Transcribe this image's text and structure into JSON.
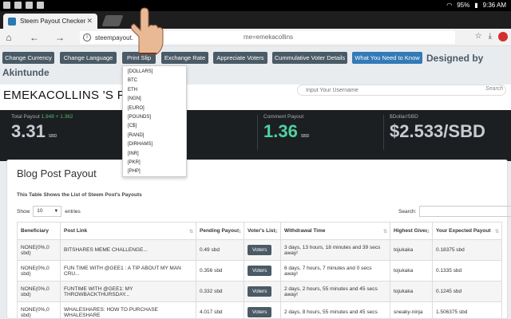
{
  "statusbar": {
    "battery": "95%",
    "time": "9:36 AM"
  },
  "browser": {
    "tab_title": "Steem Payout Checker",
    "url": "steempayout.",
    "url_tail": "me=emekacollins"
  },
  "nav": {
    "buttons": [
      "Change Currency",
      "Change Language",
      "Print Slip",
      "Exchange Rate",
      "Appreciate Voters",
      "Cummulative Voter Details",
      "What You Need to Know"
    ],
    "designed_by_1": "Designed by",
    "designed_by_2": "Akintunde"
  },
  "dropdown": [
    "[DOLLARS]",
    "BTC",
    "ETH",
    "[NGN]",
    "[EURO]",
    "[POUNDS]",
    "[C$]",
    "[RAND]",
    "[DIRHAMS]",
    "[INR]",
    "[PKR]",
    "[PHP]"
  ],
  "user": {
    "title": "EMEKACOLLINS 'S PAYO",
    "input_placeholder": "Input Your Username",
    "search_label": "Search"
  },
  "stats": {
    "total_label": "Total Payout",
    "total_detail": "1.948 + 1.362",
    "total_value": "3.31",
    "total_unit": "SBD",
    "comment_label": "Comment Payout",
    "comment_value": "1.36",
    "comment_unit": "SBD",
    "rate_label": "$Dollar/SBD",
    "rate_value": "$2.533/SBD"
  },
  "card": {
    "title": "Blog Post Payout",
    "subtitle": "This Table Shows the List of Steem Post's Payouts",
    "show_label": "Show",
    "show_value": "10",
    "entries_label": "entries",
    "search_label": "Search:"
  },
  "table": {
    "headers": [
      "Beneficiary",
      "Post Link",
      "Pending Payout",
      "Voter's List",
      "Withdrawal Time",
      "Highest Giver",
      "Your Expected Payout"
    ],
    "rows": [
      [
        "NONE(0%,0 sbd)",
        "BITSHARES MEME CHALLENGE...",
        "0.49 sbd",
        "Voters",
        "3 days, 13 hours, 18 minutes and 39 secs away!",
        "tojukaka",
        "0.18375 sbd"
      ],
      [
        "NONE(0%,0 sbd)",
        "FUN TIME WITH @GEE1 : A TIP ABOUT MY MAN CRU...",
        "0.356 sbd",
        "Voters",
        "6 days, 7 hours, 7 minutes and 0 secs away!",
        "tojukaka",
        "0.1335 sbd"
      ],
      [
        "NONE(0%,0 sbd)",
        "FUNTIME WITH @GEE1: MY THROWBACKTHURSDAY...",
        "0.332 sbd",
        "Voters",
        "2 days, 2 hours, 55 minutes and 45 secs away!",
        "tojukaka",
        "0.1245 sbd"
      ],
      [
        "NONE(0%,0 sbd)",
        "WHALESHARES: HOW TO PURCHASE WHALESHARE",
        "4.017 sbd",
        "Voters",
        "2 days, 8 hours, 55 minutes and 45 secs",
        "sneaky-ninja",
        "1.506375 sbd"
      ]
    ]
  }
}
